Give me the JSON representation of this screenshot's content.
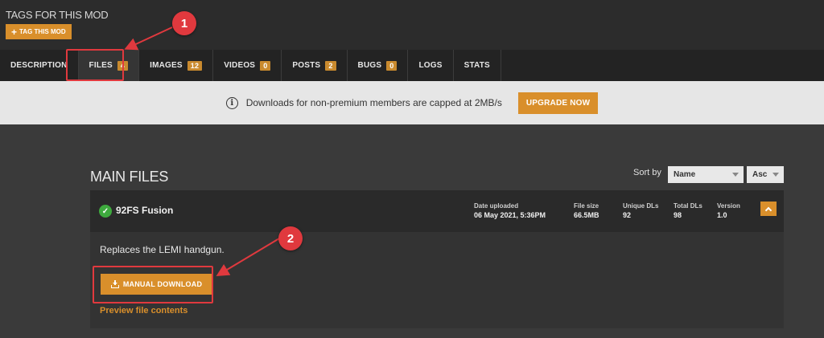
{
  "tags": {
    "title": "TAGS FOR THIS MOD",
    "button_label": "TAG THIS MOD"
  },
  "tabs": [
    {
      "label": "DESCRIPTION",
      "badge": null,
      "active": false
    },
    {
      "label": "FILES",
      "badge": "4",
      "active": true
    },
    {
      "label": "IMAGES",
      "badge": "12",
      "active": false
    },
    {
      "label": "VIDEOS",
      "badge": "0",
      "active": false
    },
    {
      "label": "POSTS",
      "badge": "2",
      "active": false
    },
    {
      "label": "BUGS",
      "badge": "0",
      "active": false
    },
    {
      "label": "LOGS",
      "badge": null,
      "active": false
    },
    {
      "label": "STATS",
      "badge": null,
      "active": false
    }
  ],
  "notice": {
    "text": "Downloads for non-premium members are capped at 2MB/s",
    "button_label": "UPGRADE NOW",
    "icon": "info-icon"
  },
  "main_files": {
    "title": "MAIN FILES",
    "sort_label": "Sort by",
    "sort_field": "Name",
    "sort_order": "Asc"
  },
  "file": {
    "name": "92FS Fusion",
    "status_icon": "check-circle-icon",
    "stats": {
      "date_label": "Date uploaded",
      "date_value": "06 May 2021, 5:36PM",
      "size_label": "File size",
      "size_value": "66.5MB",
      "unique_label": "Unique DLs",
      "unique_value": "92",
      "total_label": "Total DLs",
      "total_value": "98",
      "version_label": "Version",
      "version_value": "1.0"
    },
    "description": "Replaces the LEMI handgun.",
    "download_label": "MANUAL DOWNLOAD",
    "preview_label": "Preview file contents"
  },
  "annotations": {
    "marker_1": "1",
    "marker_2": "2",
    "color": "#e0393e"
  },
  "colors": {
    "accent": "#d98f2b",
    "badge": "#c98a2e",
    "success": "#3eaa3e"
  }
}
